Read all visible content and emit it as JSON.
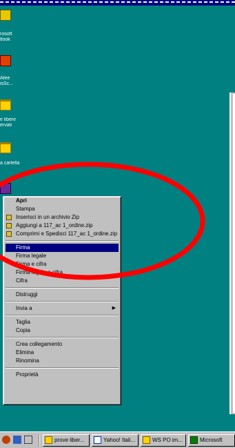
{
  "desktop": {
    "icons": [
      {
        "label_1": "rosoft",
        "label_2": "tlook"
      },
      {
        "label_1": "Afee",
        "label_2": "isSc..."
      },
      {
        "label_1": "e libere",
        "label_2": "ervati"
      },
      {
        "label_1": "a cartella"
      }
    ]
  },
  "context_menu": {
    "items": [
      {
        "label": "Apri"
      },
      {
        "label": "Stampa"
      },
      {
        "label": "Inserisci in un archivio Zip",
        "icon": "winzip-icon"
      },
      {
        "label": "Aggiungi a 117_ac 1_ordine.zip",
        "icon": "winzip-icon"
      },
      {
        "label": "Comprimi e Spedisci 117_ac 1_ordine.zip",
        "icon": "winzip-icon"
      },
      {
        "label": "Firma"
      },
      {
        "label": "Firma legale"
      },
      {
        "label": "Firma e cifra"
      },
      {
        "label": "Firma legale e cifra"
      },
      {
        "label": "Cifra"
      },
      {
        "label": "Distruggi"
      },
      {
        "label": "Invia a"
      },
      {
        "label": "Taglia"
      },
      {
        "label": "Copia"
      },
      {
        "label": "Crea collegamento"
      },
      {
        "label": "Elimina"
      },
      {
        "label": "Rinomina"
      },
      {
        "label": "Proprietà"
      }
    ]
  },
  "taskbar": {
    "buttons": [
      {
        "label": "prove liber..."
      },
      {
        "label": "Yahoo! Itali..."
      },
      {
        "label": "WS PO im..."
      },
      {
        "label": "Microsoft"
      }
    ]
  },
  "colors": {
    "desktop": "#008080",
    "menu": "#c0c0c0",
    "highlight": "#000080",
    "annotation": "#ff0000"
  }
}
